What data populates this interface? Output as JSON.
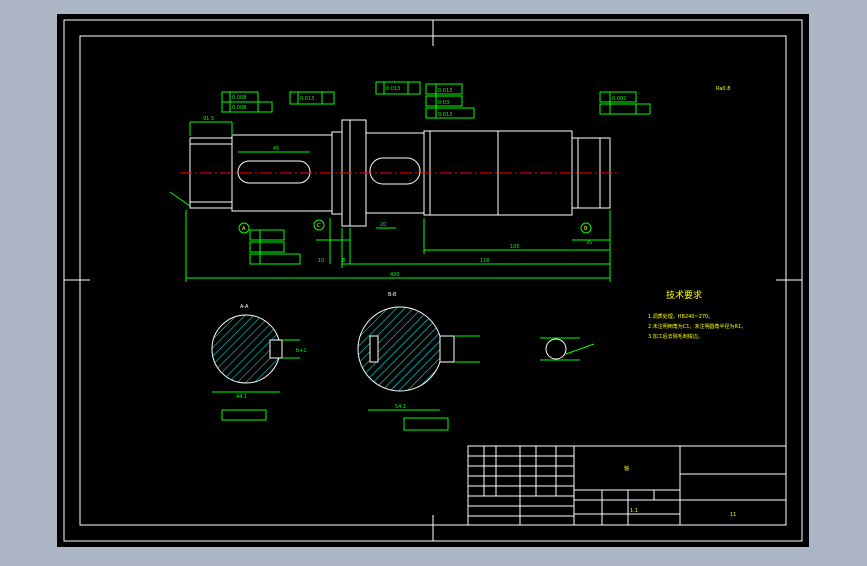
{
  "colors": {
    "background": "#abb5c3",
    "paper": "#000000",
    "outline": "#ffffff",
    "dimension": "#00ff00",
    "centerline": "#ff0000",
    "note": "#ffff00"
  },
  "dims": {
    "d_91_5": "91.5",
    "d_45": "45",
    "d_116": "116",
    "d_100": "100",
    "d_75": "75",
    "d_8": "8",
    "d_46": "46",
    "d_35": "35",
    "d_8b": "8",
    "d_20": "20",
    "d_10": "10",
    "total": "400",
    "d_bot_54": "54.1",
    "d_bot_44": "44.1",
    "d_bot_b": "b+1"
  },
  "tolerances": {
    "t1": "0.008",
    "t2": "0.008",
    "t3": "0.013",
    "t4": "0.013",
    "t5": "0.013",
    "t6": "0.03",
    "t7": "0.013",
    "t8": "0.002"
  },
  "datum": {
    "a": "A",
    "b": "B",
    "c": "C"
  },
  "sections": {
    "aa": "A-A",
    "bb": "B-B"
  },
  "roughness": {
    "r1": "Ra0.8"
  },
  "tech": {
    "title": "技术要求",
    "lines": [
      "1.调质处理，HB240~270。",
      "2.未注明倒角为C1，未注明圆角半径为R1。",
      "3.加工后去除毛刺锐边。"
    ]
  },
  "title_block": {
    "part_name": "轴",
    "company": "",
    "drawing_no": "",
    "scale": "1:1",
    "sheet": "11"
  }
}
